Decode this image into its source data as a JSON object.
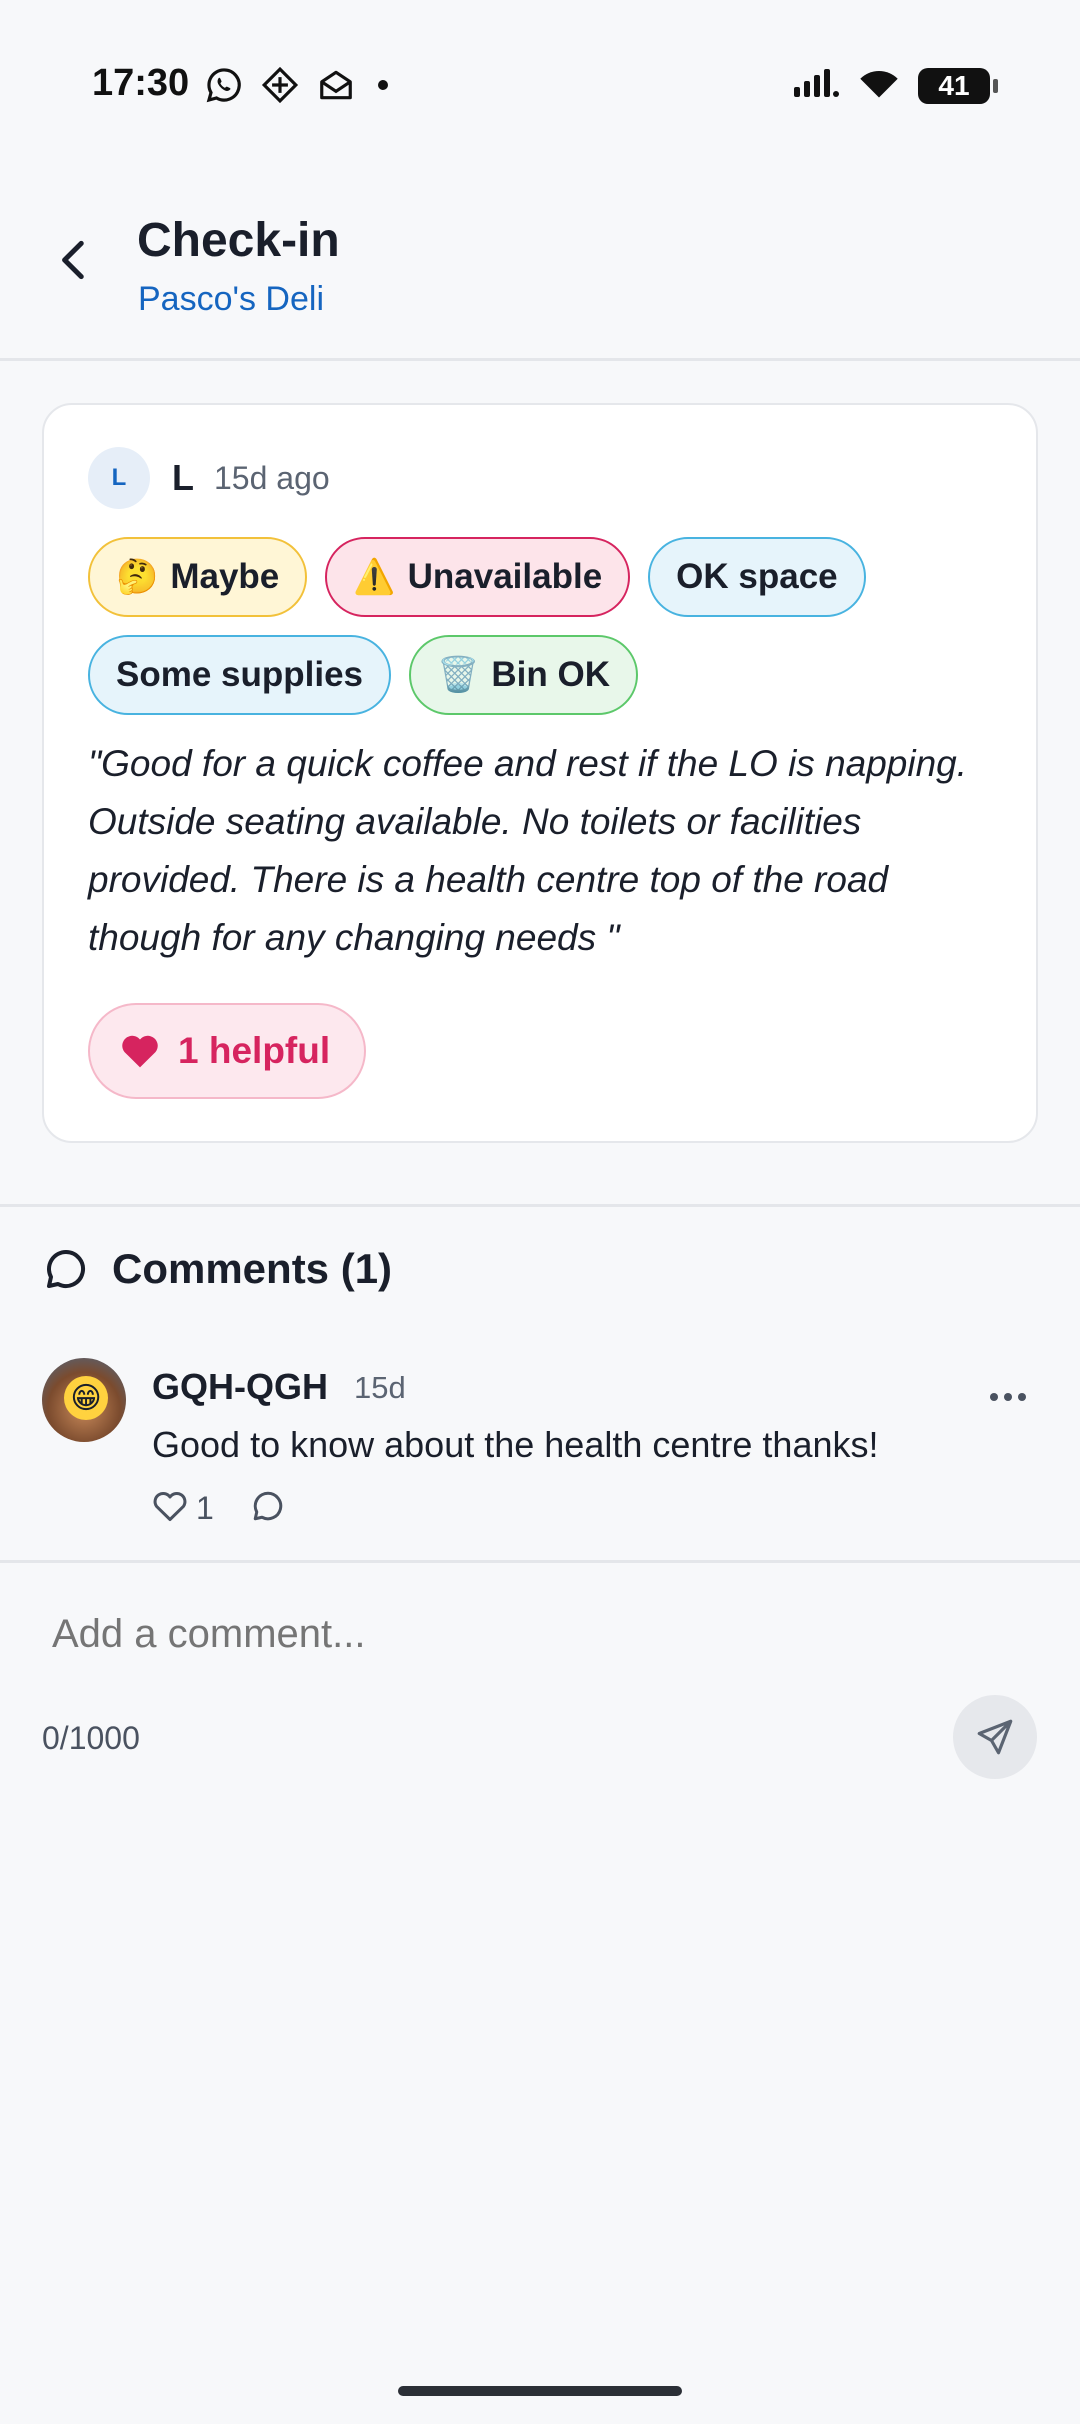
{
  "status_bar": {
    "time": "17:30",
    "battery": "41",
    "left_icons": [
      "whatsapp-icon",
      "app-icon",
      "mail-open-icon",
      "dot-icon"
    ],
    "right_icons": [
      "signal-icon",
      "wifi-icon",
      "battery-icon"
    ]
  },
  "header": {
    "title": "Check-in",
    "subtitle": "Pasco's Deli",
    "back_icon": "chevron-left-icon"
  },
  "checkin": {
    "author_initial": "L",
    "author_name": "L",
    "time_ago": "15d ago",
    "chips": [
      {
        "emoji": "🤔",
        "label": "Maybe",
        "color": "#f2c13a"
      },
      {
        "emoji": "⚠️",
        "label": "Unavailable",
        "color": "#d6245f"
      },
      {
        "emoji": "",
        "label": "OK space",
        "color": "#48b3e0"
      },
      {
        "emoji": "",
        "label": "Some supplies",
        "color": "#48b3e0"
      },
      {
        "emoji": "🗑️",
        "label": "Bin OK",
        "color": "#5cc86a"
      }
    ],
    "review_text": "\"Good for a quick coffee and rest if the LO is napping. Outside seating available. No toilets or facilities provided. There is a health centre top of the road though for any changing needs \"",
    "helpful_label": "1 helpful"
  },
  "comments": {
    "title": "Comments (1)",
    "items": [
      {
        "author": "GQH-QGH",
        "time": "15d",
        "avatar_emoji": "😁",
        "text": "Good to know about the health centre thanks!",
        "likes": "1",
        "more_label": "•••"
      }
    ]
  },
  "composer": {
    "placeholder": "Add a comment...",
    "char_count": "0/1000"
  },
  "colors": {
    "accent_blue": "#1565c0",
    "helpful_pink": "#d6245f",
    "background": "#f7f8fa"
  }
}
